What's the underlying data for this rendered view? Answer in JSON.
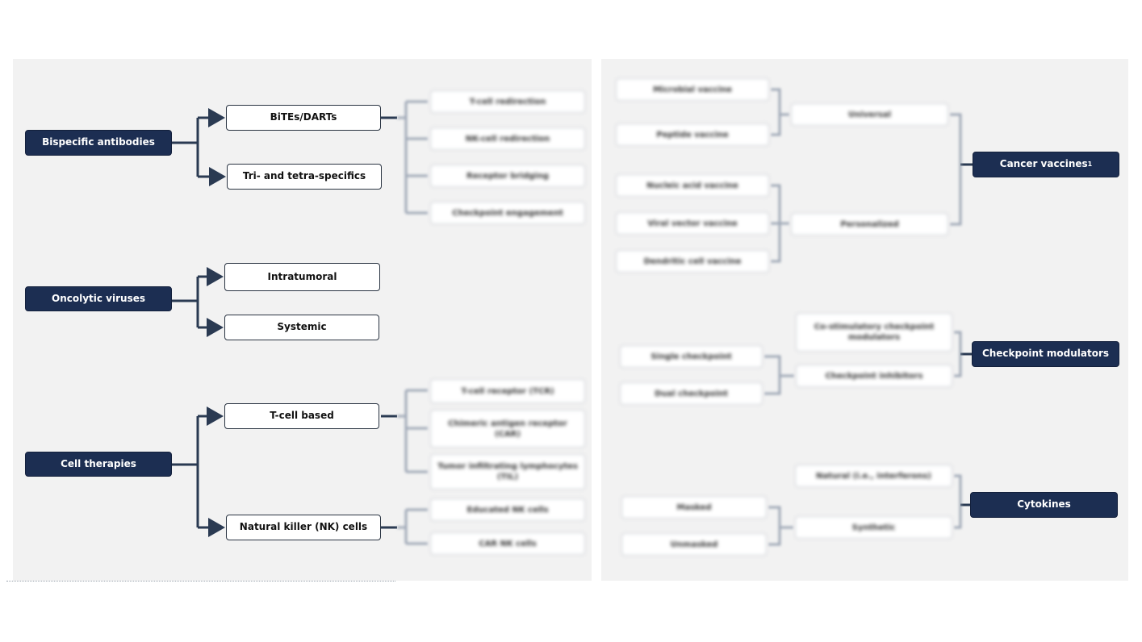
{
  "left": {
    "bispecific": {
      "title": "Bispecific antibodies",
      "children": [
        "BiTEs/DARTs",
        "Tri- and tetra-specifics"
      ],
      "bites_sub": [
        "T-cell redirection",
        "NK-cell redirection",
        "Receptor bridging",
        "Checkpoint engagement"
      ]
    },
    "oncolytic": {
      "title": "Oncolytic viruses",
      "children": [
        "Intratumoral",
        "Systemic"
      ]
    },
    "cell": {
      "title": "Cell therapies",
      "children": [
        "T-cell based",
        "Natural killer (NK) cells"
      ],
      "tcell_sub": [
        "T-cell receptor (TCR)",
        "Chimeric antigen receptor (CAR)",
        "Tumor infiltrating lymphocytes (TIL)"
      ],
      "nk_sub": [
        "Educated NK cells",
        "CAR NK cells"
      ]
    }
  },
  "right": {
    "vaccines": {
      "title": "Cancer vaccines",
      "superscript": "1",
      "middle": [
        "Universal",
        "Personalized"
      ],
      "universal_sub": [
        "Microbial vaccine",
        "Peptide vaccine"
      ],
      "personalized_sub": [
        "Nucleic acid vaccine",
        "Viral vector vaccine",
        "Dendritic cell vaccine"
      ]
    },
    "checkpoint": {
      "title": "Checkpoint modulators",
      "middle": [
        "Co-stimulatory checkpoint modulators",
        "Checkpoint inhibitors"
      ],
      "sub": [
        "Single checkpoint",
        "Dual checkpoint"
      ]
    },
    "cytokines": {
      "title": "Cytokines",
      "middle": [
        "Natural (i.e., interferons)",
        "Synthetic"
      ],
      "sub": [
        "Masked",
        "Unmasked"
      ]
    }
  },
  "colors": {
    "dark_box": "#1c2e52",
    "connector": "#2a3a52",
    "panel": "#f2f2f2"
  }
}
